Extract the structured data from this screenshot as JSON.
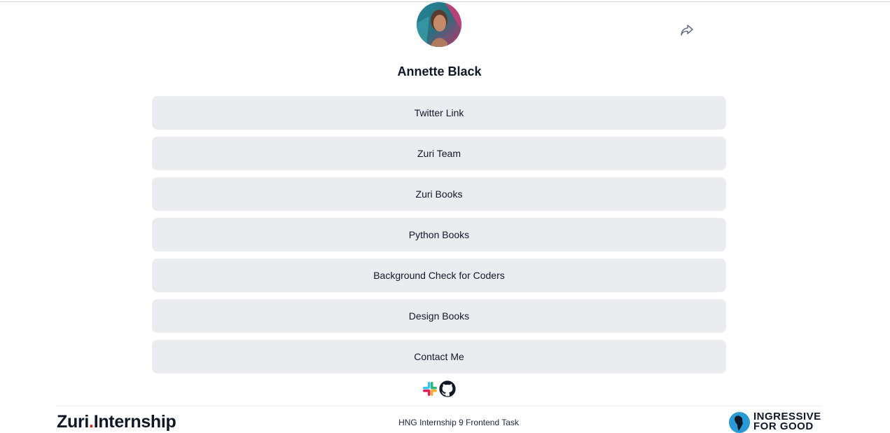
{
  "profile": {
    "name": "Annette Black",
    "avatar_icon": "profile-photo"
  },
  "share": {
    "icon": "share-icon"
  },
  "links": [
    {
      "label": "Twitter Link"
    },
    {
      "label": "Zuri Team"
    },
    {
      "label": "Zuri Books"
    },
    {
      "label": "Python Books"
    },
    {
      "label": "Background Check for Coders"
    },
    {
      "label": "Design Books"
    },
    {
      "label": "Contact Me"
    }
  ],
  "socials": [
    {
      "icon": "slack-icon"
    },
    {
      "icon": "github-icon"
    }
  ],
  "footer": {
    "zuri_brand": "Zuri",
    "zuri_dot": ".",
    "zuri_suffix": "Internship",
    "text": "HNG Internship 9 Frontend Task",
    "i4g_line1": "INGRESSIVE",
    "i4g_line2": "FOR GOOD"
  },
  "colors": {
    "button_bg": "#eaecf0",
    "text": "#101828",
    "zuri_dot": "#e11c1c"
  }
}
